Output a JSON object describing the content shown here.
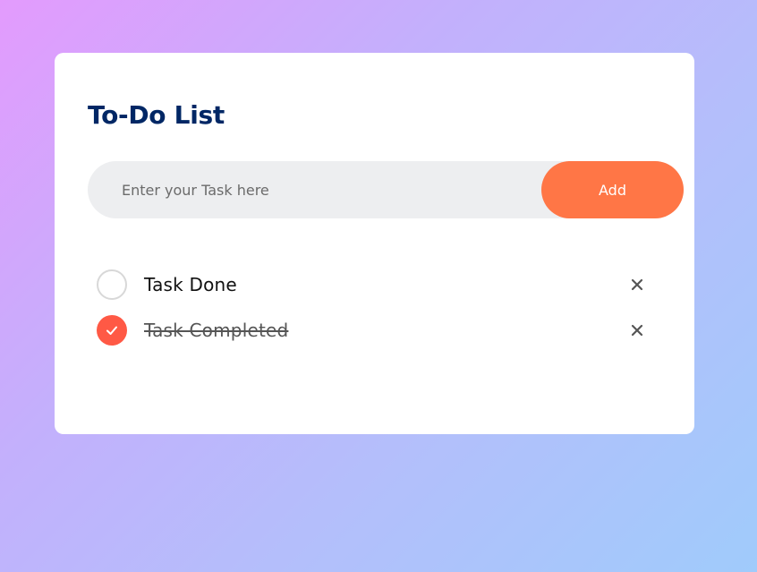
{
  "app": {
    "title": "To-Do List"
  },
  "input": {
    "placeholder": "Enter your Task here",
    "value": "",
    "add_label": "Add"
  },
  "tasks": [
    {
      "text": "Task Done",
      "completed": false,
      "delete_icon": "close-icon"
    },
    {
      "text": "Task Completed",
      "completed": true,
      "delete_icon": "close-icon"
    }
  ],
  "colors": {
    "title": "#002765",
    "accent": "#ff7646",
    "checked": "#ff5945",
    "input_bg": "#edeef0"
  }
}
